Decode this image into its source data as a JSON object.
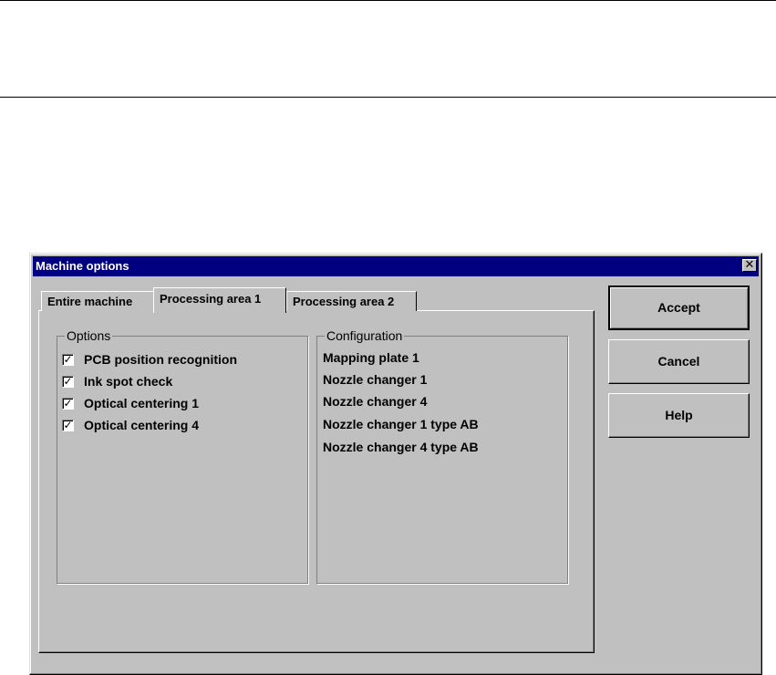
{
  "window": {
    "title": "Machine options",
    "close_glyph": "✕"
  },
  "tabs": [
    {
      "label": "Entire machine"
    },
    {
      "label": "Processing area 1",
      "active": true
    },
    {
      "label": "Processing area 2"
    }
  ],
  "options_group": {
    "label": "Options",
    "items": [
      {
        "label": "PCB position recognition",
        "checked": true
      },
      {
        "label": "Ink spot check",
        "checked": true
      },
      {
        "label": "Optical centering 1",
        "checked": true
      },
      {
        "label": "Optical centering 4",
        "checked": true
      }
    ]
  },
  "configuration_group": {
    "label": "Configuration",
    "items": [
      "Mapping plate 1",
      "Nozzle changer 1",
      "Nozzle changer 4",
      "Nozzle changer 1 type AB",
      "Nozzle changer 4 type AB"
    ]
  },
  "buttons": {
    "accept": "Accept",
    "cancel": "Cancel",
    "help": "Help"
  },
  "check_glyph": "✓",
  "colors": {
    "titlebar": "#000080",
    "face": "#c0c0c0"
  }
}
